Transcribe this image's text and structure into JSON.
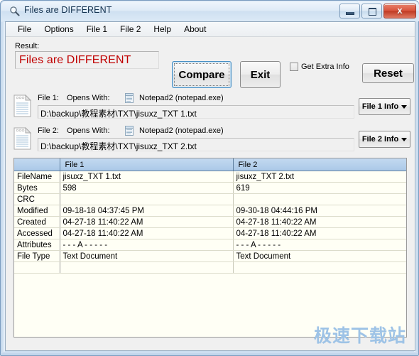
{
  "window": {
    "title": "Files are DIFFERENT",
    "icon": "magnifier-icon",
    "minimize_label": "Minimize",
    "maximize_label": "Maximize",
    "close_label": "x"
  },
  "menu": {
    "items": [
      {
        "label": "File"
      },
      {
        "label": "Options"
      },
      {
        "label": "File 1"
      },
      {
        "label": "File 2"
      },
      {
        "label": "Help"
      },
      {
        "label": "About"
      }
    ]
  },
  "result": {
    "label": "Result:",
    "value": "Files are DIFFERENT",
    "color": "#c00000"
  },
  "toolbar": {
    "compare_label": "Compare",
    "exit_label": "Exit",
    "reset_label": "Reset",
    "extra_info_label": "Get Extra Info",
    "extra_info_checked": false
  },
  "files": [
    {
      "label": "File 1:",
      "opens_with_label": "Opens With:",
      "application": "Notepad2 (notepad.exe)",
      "path": "D:\\backup\\教程素材\\TXT\\jisuxz_TXT 1.txt",
      "info_button": "File 1 Info"
    },
    {
      "label": "File 2:",
      "opens_with_label": "Opens With:",
      "application": "Notepad2 (notepad.exe)",
      "path": "D:\\backup\\教程素材\\TXT\\jisuxz_TXT 2.txt",
      "info_button": "File 2 Info"
    }
  ],
  "table": {
    "headers": [
      "",
      "File 1",
      "File 2"
    ],
    "rows": [
      {
        "name": "FileName",
        "file1": "jisuxz_TXT 1.txt",
        "file2": "jisuxz_TXT 2.txt",
        "diff": true
      },
      {
        "name": "Bytes",
        "file1": "598",
        "file2": "619",
        "diff": true
      },
      {
        "name": "CRC",
        "file1": "",
        "file2": "",
        "diff": false
      },
      {
        "name": "Modified",
        "file1": "09-18-18  04:37:45  PM",
        "file2": "09-30-18  04:44:16  PM",
        "diff": true
      },
      {
        "name": "Created",
        "file1": "04-27-18  11:40:22  AM",
        "file2": "04-27-18  11:40:22  AM",
        "diff": false
      },
      {
        "name": "Accessed",
        "file1": "04-27-18  11:40:22  AM",
        "file2": "04-27-18  11:40:22  AM",
        "diff": false
      },
      {
        "name": "Attributes",
        "file1": "- - - A - - - - -",
        "file2": "- - - A - - - - -",
        "diff": false
      },
      {
        "name": "File Type",
        "file1": "Text Document",
        "file2": "Text Document",
        "diff": false
      },
      {
        "name": "",
        "file1": "",
        "file2": "",
        "diff": false
      }
    ]
  },
  "watermark": {
    "text": "极速下载站"
  }
}
